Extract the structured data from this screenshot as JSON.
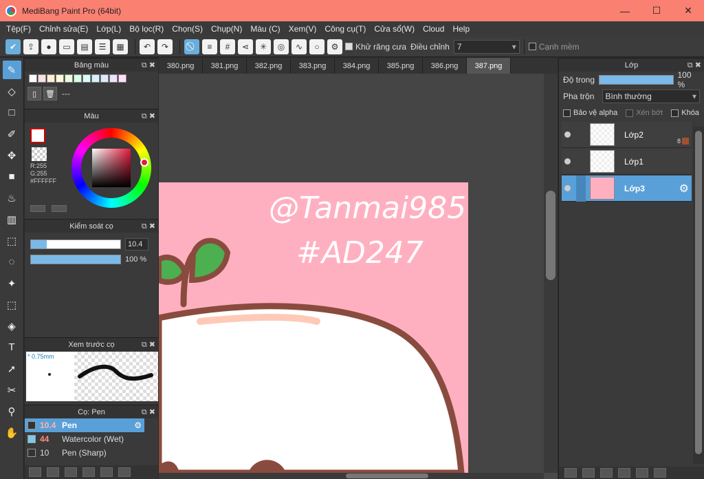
{
  "window": {
    "title": "MediBang Paint Pro (64bit)",
    "minimize_glyph": "—",
    "maximize_glyph": "☐",
    "close_glyph": "✕"
  },
  "menu": [
    "Tệp(F)",
    "Chỉnh sửa(E)",
    "Lớp(L)",
    "Bộ lọc(R)",
    "Chọn(S)",
    "Chụp(N)",
    "Màu (C)",
    "Xem(V)",
    "Công cụ(T)",
    "Cửa sổ(W)",
    "Cloud",
    "Help"
  ],
  "toolbar": {
    "antialias_label": "Khử răng cưa",
    "adjust_label": "Điều chỉnh",
    "adjust_value": "7",
    "soft_edge_label": "Cạnh mềm"
  },
  "palette_panel": {
    "title": "Bảng màu",
    "name_value": "---"
  },
  "color_panel": {
    "title": "Màu",
    "rgb_r": "R:255",
    "rgb_g": "G:255",
    "hex": "#FFFFFF",
    "hue_hex": "#e8193c"
  },
  "brush_control": {
    "title": "Kiểm soát cọ",
    "size_value": "10.4",
    "size_fraction": 0.18,
    "opacity_value": "100 %",
    "opacity_fraction": 1.0
  },
  "brush_preview": {
    "title": "Xem trước cọ",
    "size_label": "* 0.75mm"
  },
  "brush_list": {
    "title": "Cọ: Pen",
    "items": [
      {
        "size": "10.4",
        "name": "Pen",
        "color": "#333333",
        "selected": true
      },
      {
        "size": "44",
        "name": "Watercolor (Wet)",
        "color": "#7ec8e8",
        "selected": false
      },
      {
        "size": "10",
        "name": "Pen (Sharp)",
        "color": "#333333",
        "selected": false
      }
    ]
  },
  "tabs": [
    "380.png",
    "381.png",
    "382.png",
    "383.png",
    "384.png",
    "385.png",
    "386.png",
    "387.png"
  ],
  "active_tab_index": 7,
  "canvas": {
    "watermark_line1": "@Tanmai985",
    "watermark_line2": "#AD247"
  },
  "layers_panel": {
    "title": "Lớp",
    "opacity_label": "Độ trong",
    "opacity_value": "100 %",
    "opacity_fraction": 1.0,
    "blend_label": "Pha trộn",
    "blend_value": "Bình thường",
    "protect_alpha": "Bảo vệ alpha",
    "clipping": "Xén bớt",
    "lock": "Khóa",
    "layers": [
      {
        "name": "Lớp2",
        "badge": "8",
        "selected": false
      },
      {
        "name": "Lớp1",
        "badge": "",
        "selected": false
      },
      {
        "name": "Lớp3",
        "badge": "",
        "selected": true
      }
    ]
  },
  "colors": {
    "accent": "#5aa0d8",
    "canvas_pink": "#ffb0c0",
    "title_bar": "#fa8072"
  }
}
